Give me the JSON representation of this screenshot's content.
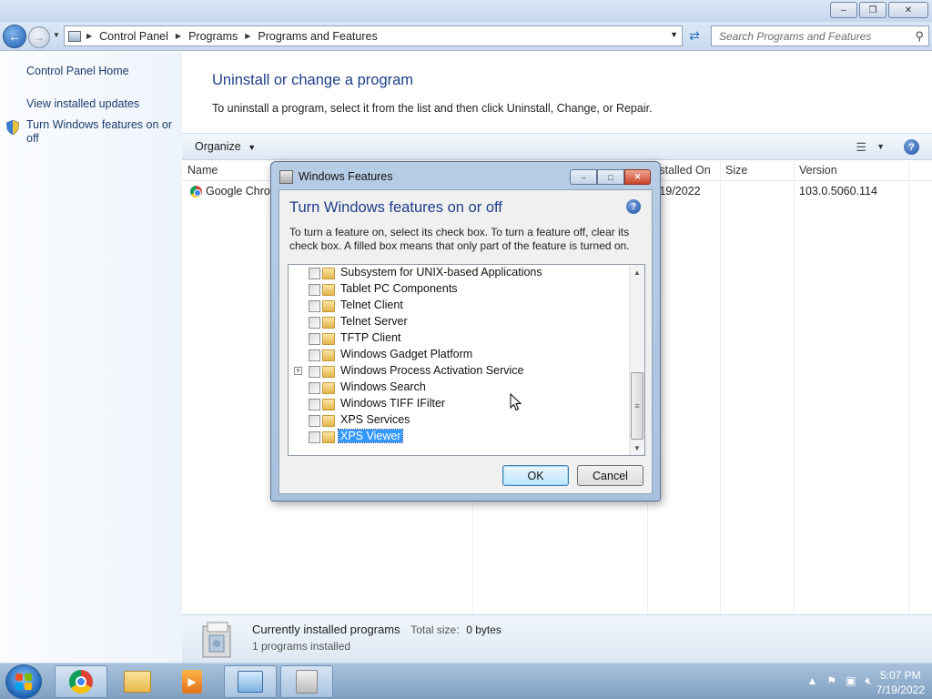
{
  "explorer": {
    "address": {
      "crumbs": [
        "Control Panel",
        "Programs",
        "Programs and Features"
      ]
    },
    "search_placeholder": "Search Programs and Features",
    "left_pane": {
      "home": "Control Panel Home",
      "view_updates": "View installed updates",
      "features_line1": "Turn Windows features on or",
      "features_line2": "off"
    },
    "main": {
      "title": "Uninstall or change a program",
      "description": "To uninstall a program, select it from the list and then click Uninstall, Change, or Repair.",
      "organize": "Organize",
      "columns": {
        "name": "Name",
        "installed_on": "Installed On",
        "size": "Size",
        "version": "Version"
      },
      "programs": [
        {
          "name": "Google Chrome",
          "installed_on": "7/19/2022",
          "size": "",
          "version": "103.0.5060.114"
        }
      ]
    },
    "details": {
      "title": "Currently installed programs",
      "total_label": "Total size:",
      "total_value": "0 bytes",
      "count": "1 programs installed"
    }
  },
  "dialog": {
    "window_title": "Windows Features",
    "heading": "Turn Windows features on or off",
    "description": "To turn a feature on, select its check box. To turn a feature off, clear its check box. A filled box means that only part of the feature is turned on.",
    "features": [
      {
        "label": "Subsystem for UNIX-based Applications",
        "expandable": false,
        "checked": false,
        "selected": false
      },
      {
        "label": "Tablet PC Components",
        "expandable": false,
        "checked": false,
        "selected": false
      },
      {
        "label": "Telnet Client",
        "expandable": false,
        "checked": false,
        "selected": false
      },
      {
        "label": "Telnet Server",
        "expandable": false,
        "checked": false,
        "selected": false
      },
      {
        "label": "TFTP Client",
        "expandable": false,
        "checked": false,
        "selected": false
      },
      {
        "label": "Windows Gadget Platform",
        "expandable": false,
        "checked": false,
        "selected": false
      },
      {
        "label": "Windows Process Activation Service",
        "expandable": true,
        "checked": false,
        "selected": false
      },
      {
        "label": "Windows Search",
        "expandable": false,
        "checked": false,
        "selected": false
      },
      {
        "label": "Windows TIFF IFilter",
        "expandable": false,
        "checked": false,
        "selected": false
      },
      {
        "label": "XPS Services",
        "expandable": false,
        "checked": false,
        "selected": false
      },
      {
        "label": "XPS Viewer",
        "expandable": false,
        "checked": false,
        "selected": true
      }
    ],
    "ok": "OK",
    "cancel": "Cancel"
  },
  "taskbar": {
    "time": "5:07 PM",
    "date": "7/19/2022"
  },
  "colors": {
    "link_blue": "#1e3f8b",
    "selection": "#3399ff",
    "taskbar": "#7f9fc1"
  }
}
